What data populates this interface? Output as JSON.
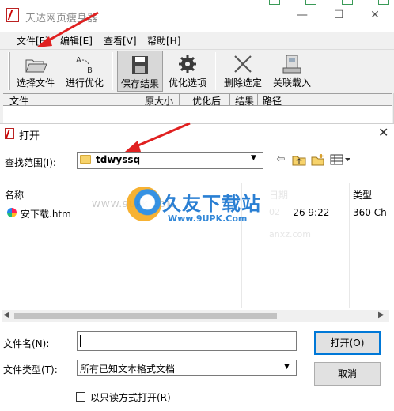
{
  "app": {
    "title": "天达网页瘦身器",
    "window_buttons": {
      "minimize": "—",
      "maximize": "☐",
      "close": "✕"
    },
    "menu": [
      "文件[F]",
      "编辑[E]",
      "查看[V]",
      "帮助[H]"
    ],
    "toolbar": [
      {
        "label": "选择文件",
        "icon": "open-folder-icon"
      },
      {
        "label": "进行优化",
        "icon": "optimize-ab-icon"
      },
      {
        "label": "保存结果",
        "icon": "floppy-disk-icon"
      },
      {
        "label": "优化选项",
        "icon": "gear-icon"
      },
      {
        "label": "删除选定",
        "icon": "delete-cross-icon"
      },
      {
        "label": "关联载入",
        "icon": "associate-load-icon"
      }
    ],
    "list_columns": [
      "文件",
      "原大小",
      "优化后",
      "结果",
      "路径"
    ]
  },
  "dialog": {
    "title": "打开",
    "close": "✕",
    "look_in_label": "查找范围(I):",
    "look_in_value": "tdwyssq",
    "columns": {
      "name": "名称",
      "date": "日期",
      "type": "类型"
    },
    "files": [
      {
        "name": "安下载.htm",
        "date": "-26 9:22",
        "type": "360 Ch"
      }
    ],
    "filename_label": "文件名(N):",
    "filename_value": "",
    "filetype_label": "文件类型(T):",
    "filetype_value": "所有已知文本格式文档",
    "open_button": "打开(O)",
    "cancel_button": "取消",
    "readonly_label": "以只读方式打开(R)"
  },
  "watermark": {
    "site": "WWW.9UPK.COM",
    "brand": "久友下载站",
    "url": "Www.9UPK.Com",
    "faint_text": "anxz.com",
    "faint_text2": "02",
    "faint_text3": "日期"
  },
  "colors": {
    "accent": "#0078d7",
    "arrow": "#e02020",
    "brand": "#2a7fd3"
  }
}
